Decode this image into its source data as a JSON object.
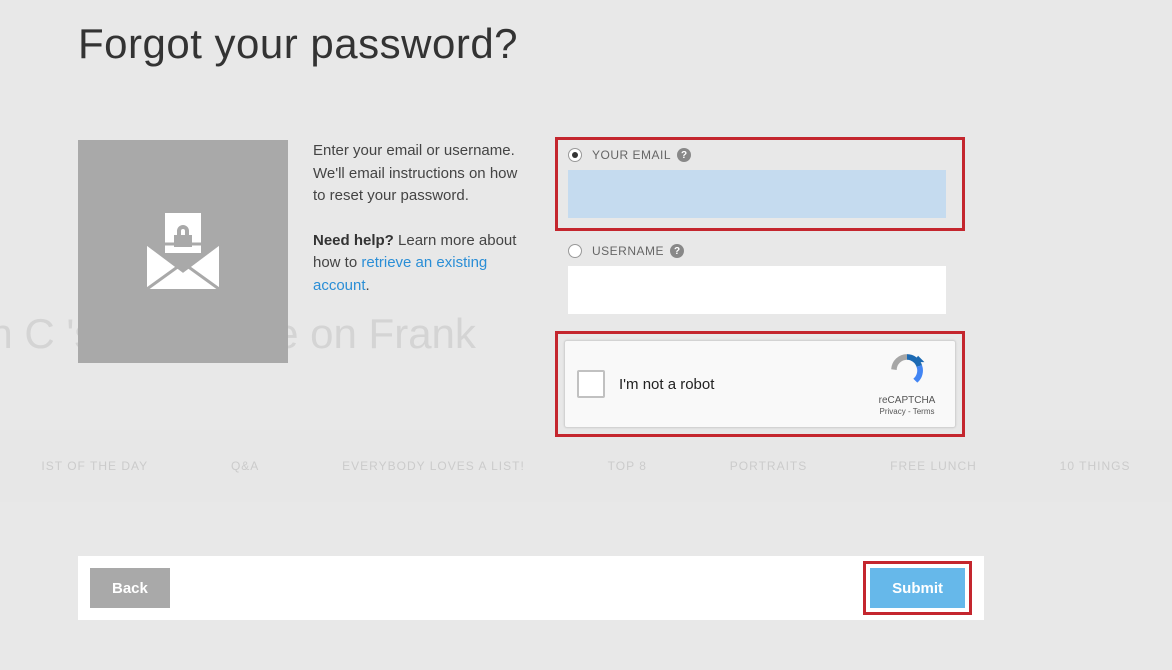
{
  "title": "Forgot your password?",
  "instructions": {
    "main": "Enter your email or username. We'll email instructions on how to reset your password.",
    "help_prefix": "Need help?",
    "help_text": " Learn more about how to ",
    "link_text": "retrieve an existing account"
  },
  "form": {
    "email_label": "YOUR EMAIL",
    "email_value": "",
    "username_label": "USERNAME",
    "username_value": ""
  },
  "recaptcha": {
    "text": "I'm not a robot",
    "brand": "reCAPTCHA",
    "privacy": "Privacy",
    "terms": "Terms"
  },
  "buttons": {
    "back": "Back",
    "submit": "Submit"
  },
  "background_nav": [
    "IST OF THE DAY",
    "Q&A",
    "EVERYBODY LOVES A LIST!",
    "TOP 8",
    "PORTRAITS",
    "FREE LUNCH",
    "10 THINGS"
  ],
  "background_text": "in C                             's Own Lane on Frank"
}
